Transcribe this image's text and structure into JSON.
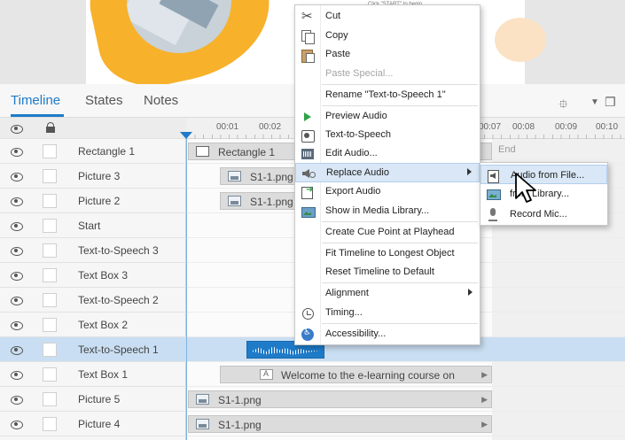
{
  "stage": {
    "hint_text": "Click \"START\" to begin"
  },
  "panel_tabs": [
    {
      "label": "Timeline",
      "active": true
    },
    {
      "label": "States",
      "active": false
    },
    {
      "label": "Notes",
      "active": false
    }
  ],
  "ruler": {
    "ticks": [
      "00:01",
      "00:02",
      "00:07",
      "00:08",
      "00:09",
      "00:10"
    ],
    "end_label": "End"
  },
  "layers": [
    {
      "name": "Rectangle 1"
    },
    {
      "name": "Picture 3"
    },
    {
      "name": "Picture 2"
    },
    {
      "name": "Start"
    },
    {
      "name": "Text-to-Speech 3"
    },
    {
      "name": "Text Box 3"
    },
    {
      "name": "Text-to-Speech 2"
    },
    {
      "name": "Text Box 2"
    },
    {
      "name": "Text-to-Speech 1",
      "selected": true
    },
    {
      "name": "Text Box 1"
    },
    {
      "name": "Picture 5"
    },
    {
      "name": "Picture 4"
    }
  ],
  "timeline_bars": {
    "rectangle_1": "Rectangle 1",
    "picture_3": "S1-1.png",
    "picture_2": "S1-1.png",
    "text_box_1": "Welcome to the e-learning course on",
    "picture_5": "S1-1.png",
    "picture_4": "S1-1.png"
  },
  "context_menu": {
    "cut": "Cut",
    "copy": "Copy",
    "paste": "Paste",
    "paste_special": "Paste Special...",
    "rename": "Rename \"Text-to-Speech 1\"",
    "preview_audio": "Preview Audio",
    "text_to_speech": "Text-to-Speech",
    "edit_audio": "Edit Audio...",
    "replace_audio": "Replace Audio",
    "export_audio": "Export Audio",
    "show_in_media_library": "Show in Media Library...",
    "create_cue_point": "Create Cue Point at Playhead",
    "fit_timeline": "Fit Timeline to Longest Object",
    "reset_timeline": "Reset Timeline to Default",
    "alignment": "Alignment",
    "timing": "Timing...",
    "accessibility": "Accessibility..."
  },
  "submenu": {
    "audio_from_file": "Audio from File...",
    "from_library": "from Library...",
    "record_mic": "Record Mic..."
  },
  "colors": {
    "accent": "#1f7bc8",
    "selected_row": "#c9def2",
    "menu_hover": "#d9e7f6",
    "audio_bar": "#1f7bc8"
  }
}
